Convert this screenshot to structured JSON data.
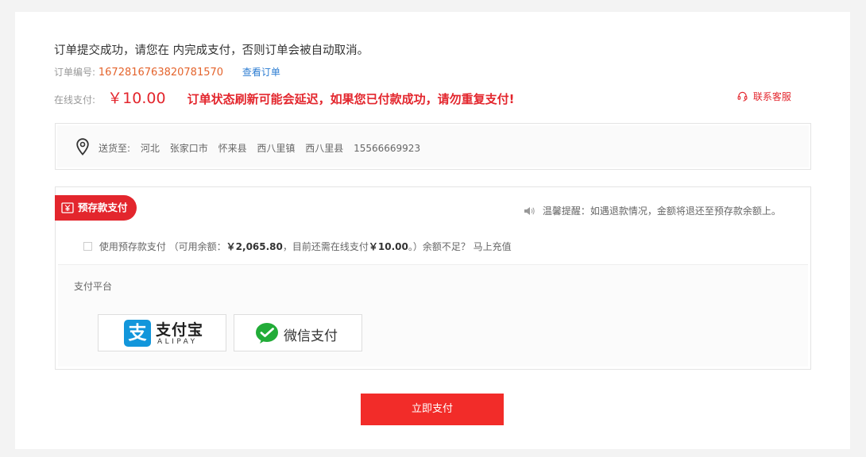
{
  "header": {
    "notice": "订单提交成功，请您在 内完成支付，否则订单会被自动取消。",
    "order_label": "订单编号:",
    "order_number": "1672816763820781570",
    "view_order": "查看订单",
    "online_pay_label": "在线支付:",
    "amount": "￥10.00",
    "warning": "订单状态刷新可能会延迟，如果您已付款成功，请勿重复支付!",
    "service": "联系客服"
  },
  "address": {
    "label": "送货至:",
    "parts": [
      "河北",
      "张家口市",
      "怀来县",
      "西八里镇",
      "西八里县",
      "15566669923"
    ]
  },
  "payment": {
    "tag": "预存款支付",
    "tip": "温馨提醒：如遇退款情况，金额将退还至预存款余额上。",
    "deposit": {
      "prefix": "使用预存款支付 （可用余额：",
      "balance": "￥2,065.80",
      "middle": "，目前还需在线支付",
      "needed": "￥10.00",
      "suffix": "。）余额不足？ 马上充值"
    },
    "platform_label": "支付平台",
    "methods": {
      "alipay_cn": "支付宝",
      "alipay_en": "ALIPAY",
      "wechat": "微信支付"
    }
  },
  "submit_label": "立即支付",
  "colors": {
    "accent": "#e3262d",
    "button": "#f22c29",
    "order_number": "#e4642d",
    "link": "#2d7dd2",
    "alipay": "#1296db",
    "wechat": "#22ac38"
  }
}
